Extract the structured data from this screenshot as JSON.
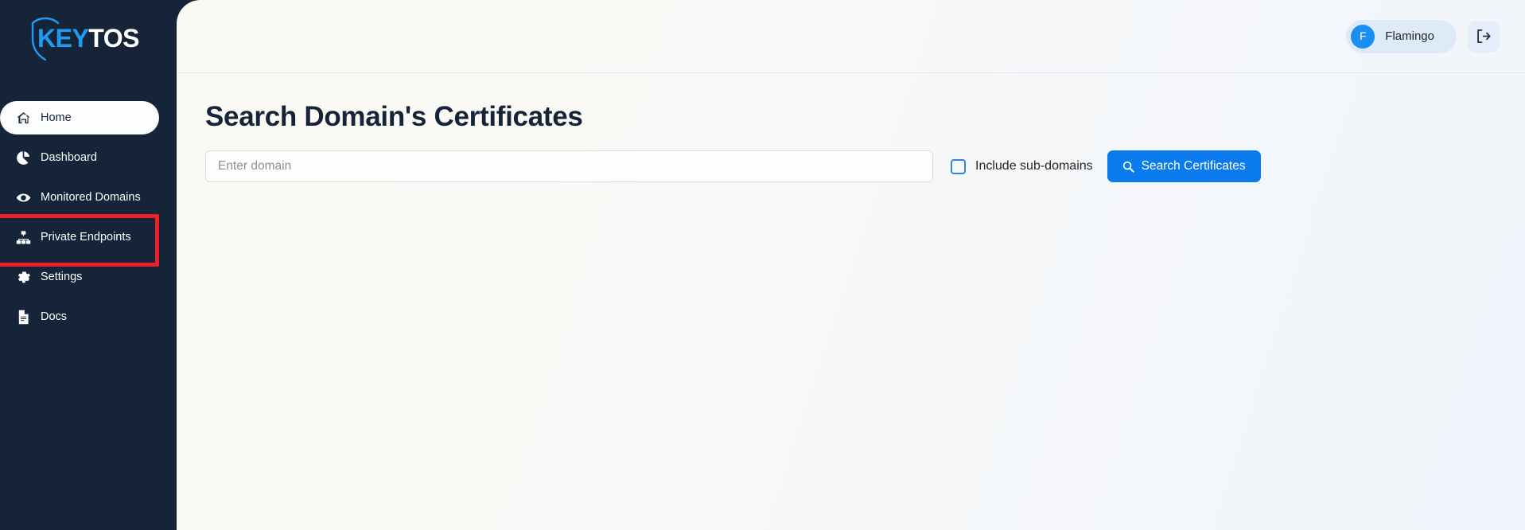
{
  "brand": {
    "logo_text_primary": "KEY",
    "logo_text_secondary": "TOS",
    "logo_icon": "shield-icon",
    "color_primary": "#1f9cf0",
    "color_sidebar": "#152438"
  },
  "sidebar": {
    "items": [
      {
        "label": "Home",
        "icon": "home-icon",
        "active": true,
        "highlighted": false
      },
      {
        "label": "Dashboard",
        "icon": "pie-chart-icon",
        "active": false,
        "highlighted": false
      },
      {
        "label": "Monitored Domains",
        "icon": "eye-icon",
        "active": false,
        "highlighted": false
      },
      {
        "label": "Private Endpoints",
        "icon": "sitemap-icon",
        "active": false,
        "highlighted": true
      },
      {
        "label": "Settings",
        "icon": "gear-icon",
        "active": false,
        "highlighted": false
      },
      {
        "label": "Docs",
        "icon": "document-icon",
        "active": false,
        "highlighted": false
      }
    ],
    "highlight_color": "#ed2028"
  },
  "topbar": {
    "user": {
      "name": "Flamingo",
      "avatar_initial": "F",
      "avatar_color": "#1b8ef2",
      "pill_color": "#dfeaf8"
    },
    "logout": {
      "icon": "sign-out-icon",
      "title": "Sign out"
    }
  },
  "main": {
    "title": "Search Domain's Certificates",
    "search": {
      "input_value": "",
      "placeholder": "Enter domain",
      "include_subdomains": {
        "label": "Include sub-domains",
        "checked": false
      },
      "submit": {
        "label": "Search Certificates",
        "icon": "search-icon",
        "color": "#0b7aec"
      }
    },
    "results": []
  }
}
